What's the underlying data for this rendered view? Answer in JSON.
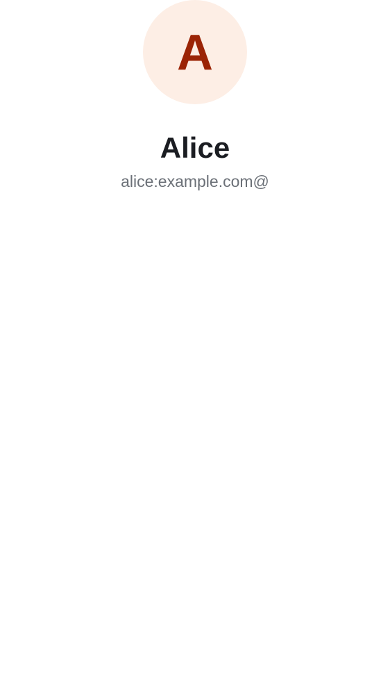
{
  "profile": {
    "avatar_initial": "A",
    "display_name": "Alice",
    "user_id": "alice:example.com@"
  },
  "colors": {
    "avatar_background": "#fdeee5",
    "avatar_letter": "#9b2406",
    "name_text": "#1b1d22",
    "secondary_text": "#6b7077"
  }
}
